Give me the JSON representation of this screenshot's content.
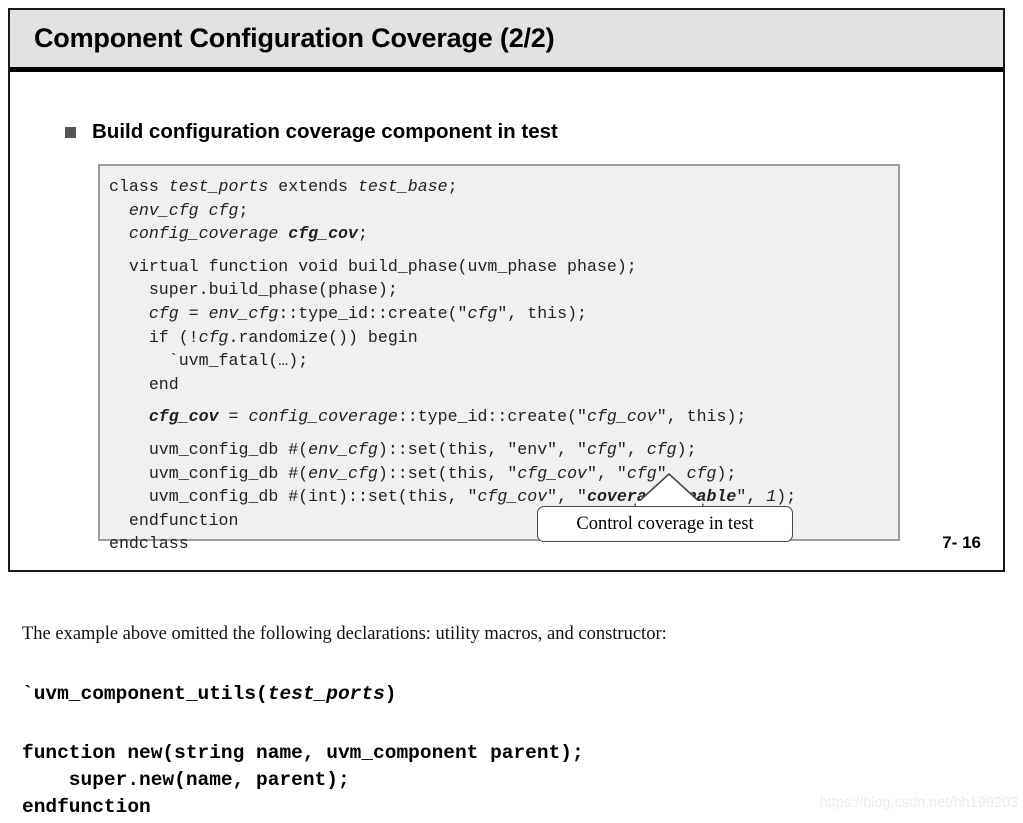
{
  "slide": {
    "title": "Component Configuration Coverage (2/2)",
    "bullet": {
      "marker": "square-bullet-icon",
      "text": "Build configuration coverage component in test"
    },
    "page_number": "7- 16",
    "code": {
      "lines": [
        [
          {
            "t": "class ",
            "s": "roman"
          },
          {
            "t": "test_ports",
            "s": "italic"
          },
          {
            "t": " extends ",
            "s": "roman"
          },
          {
            "t": "test_base",
            "s": "italic"
          },
          {
            "t": ";",
            "s": "roman"
          }
        ],
        [
          {
            "t": "  ",
            "s": "roman"
          },
          {
            "t": "env_cfg cfg",
            "s": "italic"
          },
          {
            "t": ";",
            "s": "roman"
          }
        ],
        [
          {
            "t": "  ",
            "s": "roman"
          },
          {
            "t": "config_coverage ",
            "s": "italic"
          },
          {
            "t": "cfg_cov",
            "s": "bolditalic"
          },
          {
            "t": ";",
            "s": "roman"
          }
        ],
        [
          {
            "t": "  virtual function void build_phase(uvm_phase phase);",
            "s": "roman",
            "gap": true
          }
        ],
        [
          {
            "t": "    super.build_phase(phase);",
            "s": "roman"
          }
        ],
        [
          {
            "t": "    ",
            "s": "roman"
          },
          {
            "t": "cfg",
            "s": "italic"
          },
          {
            "t": " = ",
            "s": "roman"
          },
          {
            "t": "env_cfg",
            "s": "italic"
          },
          {
            "t": "::type_id::create(\"",
            "s": "roman"
          },
          {
            "t": "cfg",
            "s": "italic"
          },
          {
            "t": "\", this);",
            "s": "roman"
          }
        ],
        [
          {
            "t": "    if (!",
            "s": "roman"
          },
          {
            "t": "cfg",
            "s": "italic"
          },
          {
            "t": ".randomize()) begin",
            "s": "roman"
          }
        ],
        [
          {
            "t": "      `uvm_fatal(…);",
            "s": "roman"
          }
        ],
        [
          {
            "t": "    end",
            "s": "roman"
          }
        ],
        [
          {
            "t": "    ",
            "s": "roman",
            "gap": true
          },
          {
            "t": "cfg_cov",
            "s": "bolditalic"
          },
          {
            "t": " = ",
            "s": "roman"
          },
          {
            "t": "config_coverage",
            "s": "italic"
          },
          {
            "t": "::type_id::create(\"",
            "s": "roman"
          },
          {
            "t": "cfg_cov",
            "s": "italic"
          },
          {
            "t": "\", this);",
            "s": "roman"
          }
        ],
        [
          {
            "t": "    uvm_config_db #(",
            "s": "roman",
            "gap": true
          },
          {
            "t": "env_cfg",
            "s": "italic"
          },
          {
            "t": ")::set(this, \"env\", \"",
            "s": "roman"
          },
          {
            "t": "cfg",
            "s": "italic"
          },
          {
            "t": "\", ",
            "s": "roman"
          },
          {
            "t": "cfg",
            "s": "italic"
          },
          {
            "t": ");",
            "s": "roman"
          }
        ],
        [
          {
            "t": "    uvm_config_db #(",
            "s": "roman"
          },
          {
            "t": "env_cfg",
            "s": "italic"
          },
          {
            "t": ")::set(this, \"",
            "s": "roman"
          },
          {
            "t": "cfg_cov",
            "s": "italic"
          },
          {
            "t": "\", \"",
            "s": "roman"
          },
          {
            "t": "cfg",
            "s": "italic"
          },
          {
            "t": "\", ",
            "s": "roman"
          },
          {
            "t": "cfg",
            "s": "italic"
          },
          {
            "t": ");",
            "s": "roman"
          }
        ],
        [
          {
            "t": "    uvm_config_db #(int)::set(this, \"",
            "s": "roman"
          },
          {
            "t": "cfg_cov",
            "s": "italic"
          },
          {
            "t": "\", \"",
            "s": "roman"
          },
          {
            "t": "coverage_enable",
            "s": "bolditalic"
          },
          {
            "t": "\", ",
            "s": "roman"
          },
          {
            "t": "1",
            "s": "italic"
          },
          {
            "t": ");",
            "s": "roman"
          }
        ],
        [
          {
            "t": "  endfunction",
            "s": "roman"
          }
        ],
        [
          {
            "t": "endclass",
            "s": "roman"
          }
        ]
      ]
    },
    "callout": {
      "text": "Control coverage in test"
    }
  },
  "notes": {
    "intro": "The example above omitted the following declarations: utility macros, and constructor:",
    "macro": [
      {
        "t": "`uvm_component_utils(",
        "s": "roman"
      },
      {
        "t": "test_ports",
        "s": "bolditalic"
      },
      {
        "t": ")",
        "s": "roman"
      }
    ],
    "constructor": [
      [
        {
          "t": "function new(string name, uvm_component parent);",
          "s": "roman"
        }
      ],
      [
        {
          "t": "    super.new(name, parent);",
          "s": "roman"
        }
      ],
      [
        {
          "t": "endfunction",
          "s": "roman"
        }
      ]
    ]
  },
  "watermark": "https://blog.csdn.net/hh199203"
}
